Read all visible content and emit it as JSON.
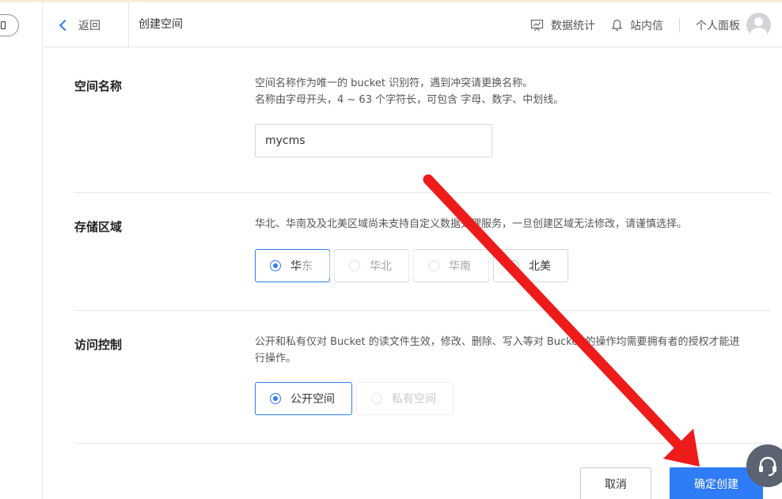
{
  "header": {
    "back_label": "返回",
    "breadcrumb": "创建空间",
    "stats_label": "数据统计",
    "messages_label": "站内信",
    "panel_label": "个人面板"
  },
  "bucket_name": {
    "title": "空间名称",
    "desc_line1": "空间名称作为唯一的 bucket 识别符，遇到冲突请更换名称。",
    "desc_line2": "名称由字母开头，4 ~ 63 个字符长，可包含 字母、数字、中划线。",
    "value": "mycms"
  },
  "storage_region": {
    "title": "存储区域",
    "desc": "华北、华南及及北美区域尚未支持自定义数据处理服务，一旦创建区域无法修改，请谨慎选择。",
    "options": [
      "华东",
      "华北",
      "华南",
      "北美"
    ],
    "selected": "华东"
  },
  "access_control": {
    "title": "访问控制",
    "desc_line1": "公开和私有仅对 Bucket 的读文件生效，修改、删除、写入等对 Bucket 的操作均需要拥有者的授权才能进",
    "desc_line2": "行操作。",
    "options": [
      "公开空间",
      "私有空间"
    ],
    "selected": "公开空间"
  },
  "footer": {
    "cancel_label": "取消",
    "confirm_label": "确定创建"
  },
  "colors": {
    "accent": "#2e7cf6",
    "annotation_arrow": "#ee1b1b"
  },
  "icons": [
    "chevron-left-icon",
    "stats-chart-icon",
    "bell-icon",
    "avatar-icon",
    "headset-icon"
  ]
}
